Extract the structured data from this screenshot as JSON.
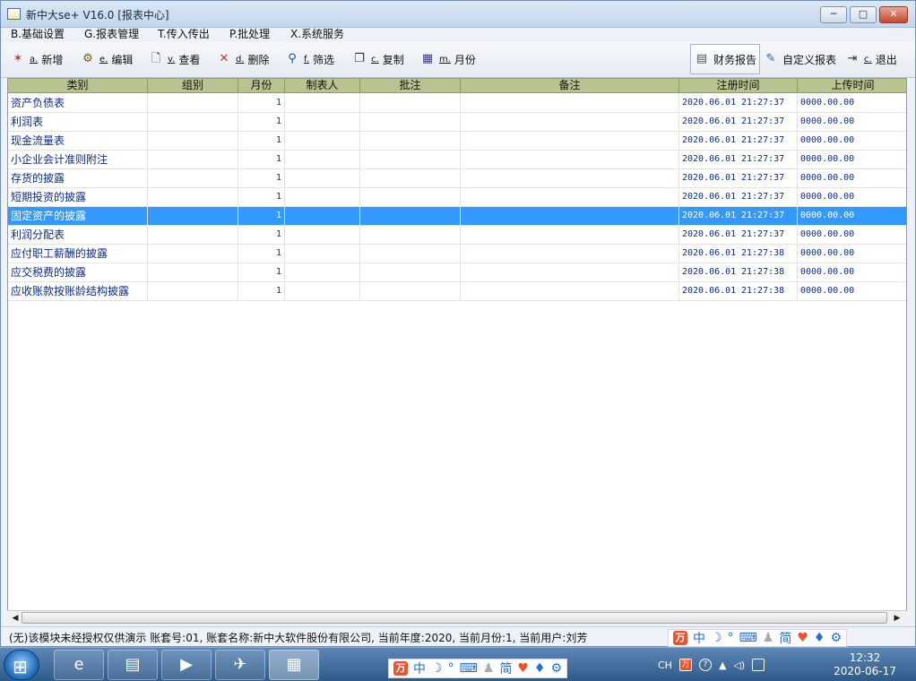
{
  "window": {
    "title": "新中大se+ V16.0 [报表中心]",
    "min_glyph": "─",
    "max_glyph": "□",
    "close_glyph": "✕"
  },
  "menu": [
    {
      "label": "B.基础设置"
    },
    {
      "label": "G.报表管理"
    },
    {
      "label": "T.传入传出"
    },
    {
      "label": "P.批处理"
    },
    {
      "label": "X.系统服务"
    }
  ],
  "toolbar": {
    "new": {
      "key": "a.",
      "label": "新增",
      "icon": "new-icon"
    },
    "edit": {
      "key": "e.",
      "label": "编辑",
      "icon": "gear-edit-icon"
    },
    "view": {
      "key": "v.",
      "label": "查看",
      "icon": "magnifier-doc-icon"
    },
    "delete": {
      "key": "d.",
      "label": "删除",
      "icon": "delete-icon"
    },
    "filter": {
      "key": "f.",
      "label": "筛选",
      "icon": "search-icon"
    },
    "copy": {
      "key": "c.",
      "label": "复制",
      "icon": "copy-icon"
    },
    "month": {
      "key": "m.",
      "label": "月份",
      "icon": "calendar-icon"
    },
    "finance_report": {
      "label": "财务报告",
      "icon": "report-icon"
    },
    "custom_report": {
      "label": "自定义报表",
      "icon": "custom-report-icon"
    },
    "exit": {
      "key": "c.",
      "label": "退出",
      "icon": "exit-icon"
    }
  },
  "table": {
    "columns": [
      "类别",
      "组别",
      "月份",
      "制表人",
      "批注",
      "备注",
      "注册时间",
      "上传时间"
    ],
    "rows": [
      {
        "category": "资产负债表",
        "group": "",
        "month": "1",
        "maker": "",
        "annotation": "",
        "remark": "",
        "reg_date": "2020.06.01",
        "reg_time": "21:27:37",
        "upload": "0000.00.00"
      },
      {
        "category": "利润表",
        "group": "",
        "month": "1",
        "maker": "",
        "annotation": "",
        "remark": "",
        "reg_date": "2020.06.01",
        "reg_time": "21:27:37",
        "upload": "0000.00.00"
      },
      {
        "category": "现金流量表",
        "group": "",
        "month": "1",
        "maker": "",
        "annotation": "",
        "remark": "",
        "reg_date": "2020.06.01",
        "reg_time": "21:27:37",
        "upload": "0000.00.00"
      },
      {
        "category": "小企业会计准则附注",
        "group": "",
        "month": "1",
        "maker": "",
        "annotation": "",
        "remark": "",
        "reg_date": "2020.06.01",
        "reg_time": "21:27:37",
        "upload": "0000.00.00"
      },
      {
        "category": "存货的披露",
        "group": "",
        "month": "1",
        "maker": "",
        "annotation": "",
        "remark": "",
        "reg_date": "2020.06.01",
        "reg_time": "21:27:37",
        "upload": "0000.00.00"
      },
      {
        "category": "短期投资的披露",
        "group": "",
        "month": "1",
        "maker": "",
        "annotation": "",
        "remark": "",
        "reg_date": "2020.06.01",
        "reg_time": "21:27:37",
        "upload": "0000.00.00"
      },
      {
        "category": "固定资产的披露",
        "group": "",
        "month": "1",
        "maker": "",
        "annotation": "",
        "remark": "",
        "reg_date": "2020.06.01",
        "reg_time": "21:27:37",
        "upload": "0000.00.00",
        "selected": true
      },
      {
        "category": "利润分配表",
        "group": "",
        "month": "1",
        "maker": "",
        "annotation": "",
        "remark": "",
        "reg_date": "2020.06.01",
        "reg_time": "21:27:37",
        "upload": "0000.00.00"
      },
      {
        "category": "应付职工薪酬的披露",
        "group": "",
        "month": "1",
        "maker": "",
        "annotation": "",
        "remark": "",
        "reg_date": "2020.06.01",
        "reg_time": "21:27:38",
        "upload": "0000.00.00"
      },
      {
        "category": "应交税费的披露",
        "group": "",
        "month": "1",
        "maker": "",
        "annotation": "",
        "remark": "",
        "reg_date": "2020.06.01",
        "reg_time": "21:27:38",
        "upload": "0000.00.00"
      },
      {
        "category": "应收账款按账龄结构披露",
        "group": "",
        "month": "1",
        "maker": "",
        "annotation": "",
        "remark": "",
        "reg_date": "2020.06.01",
        "reg_time": "21:27:38",
        "upload": "0000.00.00"
      }
    ]
  },
  "scroll": {
    "left_arrow": "◀",
    "right_arrow": "▶"
  },
  "status": {
    "text": "(无)该模块未经授权仅供演示    账套号:01,   账套名称:新中大软件股份有限公司,   当前年度:2020,  当前月份:1,  当前用户:刘芳"
  },
  "ime": {
    "brand": "万",
    "chinese": "中",
    "moon": "☽",
    "dot": "°",
    "keyboard": "⌨",
    "person": "♟",
    "simplified": "简",
    "skin": "♥",
    "shirt": "♦",
    "gear": "⚙"
  },
  "taskbar": {
    "start_glyph": "⊞",
    "apps": [
      {
        "name": "ie-browser",
        "glyph": "e"
      },
      {
        "name": "file-explorer",
        "glyph": "▤"
      },
      {
        "name": "media-player",
        "glyph": "▶"
      },
      {
        "name": "plane-app",
        "glyph": "✈"
      },
      {
        "name": "report-app",
        "glyph": "▦"
      }
    ],
    "tray_lang": "CH",
    "tray_help": "?",
    "tray_up": "▲",
    "tray_volume": "◁)",
    "clock_time": "12:32",
    "clock_date": "2020-06-17"
  }
}
